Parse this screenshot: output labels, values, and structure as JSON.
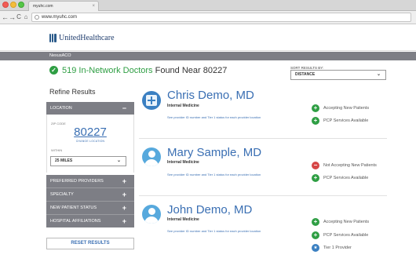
{
  "browser": {
    "tab_title": "myuhc.com",
    "tab_close": "×",
    "url": "www.myuhc.com",
    "nav": {
      "back": "←",
      "forward": "→",
      "reload": "C",
      "home": "⌂"
    }
  },
  "header": {
    "brand": "UnitedHealthcare",
    "subbrand": "NexusACO"
  },
  "results": {
    "check": "✓",
    "count_text": "519 In-Network Doctors",
    "location_text": " Found Near 80227"
  },
  "sort": {
    "label": "SORT RESULTS BY:",
    "value": "DISTANCE",
    "caret": "⌄"
  },
  "sidebar": {
    "title": "Refine Results",
    "location": {
      "label": "LOCATION",
      "toggle": "−"
    },
    "zip_label": "ZIP CODE",
    "zip_value": "80227",
    "change_location": "CHANGE LOCATION",
    "within_label": "WITHIN",
    "within_value": "25 MILES",
    "within_caret": "⌄",
    "filters": [
      {
        "label": "PREFERRED PROVIDERS",
        "toggle": "+"
      },
      {
        "label": "SPECIALTY",
        "toggle": "+"
      },
      {
        "label": "NEW PATIENT STATUS",
        "toggle": "+"
      },
      {
        "label": "HOSPITAL AFFILIATIONS",
        "toggle": "+"
      }
    ],
    "reset": "RESET RESULTS"
  },
  "providers": [
    {
      "name": "Chris Demo, MD",
      "specialty": "Internal Medicine",
      "link": "See provider ID number and Tier 1 status for each provider location",
      "statuses": [
        {
          "icon": "+",
          "text": "Accepting New Patients"
        },
        {
          "icon": "+",
          "text": "PCP Services Available"
        }
      ]
    },
    {
      "name": "Mary Sample, MD",
      "specialty": "Internal Medicine",
      "link": "See provider ID number and Tier 1 status for each provider location",
      "statuses": [
        {
          "icon": "−",
          "text": "Not Accepting New Patients"
        },
        {
          "icon": "+",
          "text": "PCP Services Available"
        }
      ]
    },
    {
      "name": "John Demo, MD",
      "specialty": "Internal Medicine",
      "link": "See provider ID number and Tier 1 status for each provider location",
      "statuses": [
        {
          "icon": "+",
          "text": "Accepting New Patients"
        },
        {
          "icon": "+",
          "text": "PCP Services Available"
        },
        {
          "icon": "★",
          "text": "Tier 1 Provider"
        }
      ]
    }
  ],
  "colors": {
    "accent_green": "#2e9e43",
    "link_blue": "#3a6fb3",
    "sidebar_gray": "#7d7e85",
    "alert_red": "#d64545"
  }
}
